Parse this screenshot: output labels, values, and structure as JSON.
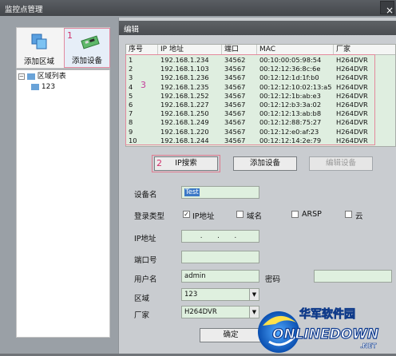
{
  "window": {
    "title": "监控点管理",
    "close_glyph": "×"
  },
  "toolbar": {
    "add_area_label": "添加区域",
    "add_device_label": "添加设备",
    "marker_1": "1"
  },
  "tree": {
    "root_label": "区域列表",
    "child_label": "123"
  },
  "dialog": {
    "title": "编辑",
    "columns": [
      "序号",
      "IP 地址",
      "端口",
      "MAC",
      "厂家"
    ],
    "rows": [
      {
        "no": "1",
        "ip": "192.168.1.234",
        "port": "34562",
        "mac": "00:10:00:05:98:54",
        "vendor": "H264DVR"
      },
      {
        "no": "2",
        "ip": "192.168.1.103",
        "port": "34567",
        "mac": "00:12:12:36:8c:6e",
        "vendor": "H264DVR"
      },
      {
        "no": "3",
        "ip": "192.168.1.236",
        "port": "34567",
        "mac": "00:12:12:1d:1f:b0",
        "vendor": "H264DVR"
      },
      {
        "no": "4",
        "ip": "192.168.1.235",
        "port": "34567",
        "mac": "00:12:12:10:02:13:a5",
        "vendor": "H264DVR"
      },
      {
        "no": "5",
        "ip": "192.168.1.252",
        "port": "34567",
        "mac": "00:12:12:1b:ab:e3",
        "vendor": "H264DVR"
      },
      {
        "no": "6",
        "ip": "192.168.1.227",
        "port": "34567",
        "mac": "00:12:12:b3:3a:02",
        "vendor": "H264DVR"
      },
      {
        "no": "7",
        "ip": "192.168.1.250",
        "port": "34567",
        "mac": "00:12:12:13:ab:b8",
        "vendor": "H264DVR"
      },
      {
        "no": "8",
        "ip": "192.168.1.249",
        "port": "34567",
        "mac": "00:12:12:88:75:27",
        "vendor": "H264DVR"
      },
      {
        "no": "9",
        "ip": "192.168.1.220",
        "port": "34567",
        "mac": "00:12:12:e0:af:23",
        "vendor": "H264DVR"
      },
      {
        "no": "10",
        "ip": "192.168.1.244",
        "port": "34567",
        "mac": "00:12:12:14:2e:79",
        "vendor": "H264DVR"
      }
    ],
    "marker_3": "3",
    "marker_2": "2",
    "ip_search_label": "IP搜索",
    "add_device_btn_label": "添加设备",
    "edit_device_btn_label": "编辑设备",
    "form": {
      "device_name_label": "设备名",
      "device_name_value": "Test",
      "login_type_label": "登录类型",
      "login_options": [
        "IP地址",
        "域名",
        "ARSP",
        "云"
      ],
      "ip_label": "IP地址",
      "ip_value": ". . .",
      "port_label": "端口号",
      "port_value": "",
      "username_label": "用户名",
      "username_value": "admin",
      "password_label": "密码",
      "password_value": "",
      "area_label": "区域",
      "area_value": "123",
      "vendor_label": "厂家",
      "vendor_value": "H264DVR",
      "confirm_label": "确定"
    }
  },
  "watermark": {
    "brand_cn": "华军软件园",
    "brand_en": "ONLINEDOWN",
    "brand_suffix": ".NET"
  },
  "colors": {
    "table_bg": "#dfeee0",
    "highlight": "#e07b90",
    "titlebar": "#4a4d51"
  }
}
